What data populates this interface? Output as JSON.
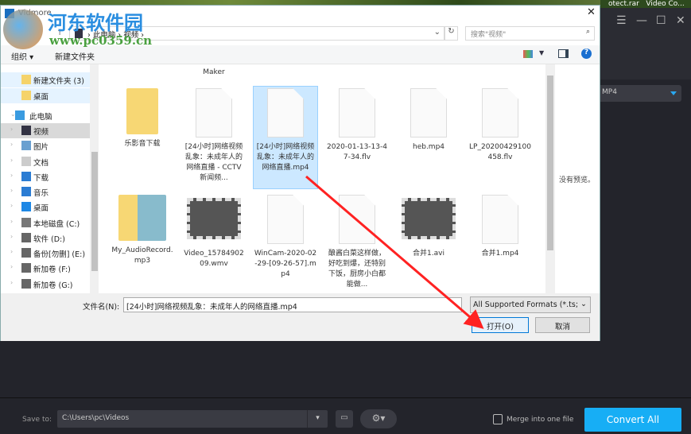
{
  "background_app": {
    "taskbar_items": [
      "otect.rar",
      "Video Co..."
    ],
    "format": "MP4",
    "save_to_label": "Save to:",
    "save_path": "C:\\Users\\pc\\Videos",
    "merge_label": "Merge into one file",
    "convert_button": "Convert All",
    "accent": "#17aef5"
  },
  "dialog": {
    "title": "Vidmore",
    "breadcrumb": [
      "此电脑",
      "视频"
    ],
    "search_placeholder": "搜索\"视频\"",
    "toolbar": {
      "organize": "组织 ▾",
      "new_folder": "新建文件夹"
    },
    "nav": [
      "新建文件夹 (3)",
      "桌面",
      "此电脑",
      "视频",
      "图片",
      "文档",
      "下载",
      "音乐",
      "桌面",
      "本地磁盘 (C:)",
      "软件 (D:)",
      "备份[勿删] (E:)",
      "新加卷 (F:)",
      "新加卷 (G:)"
    ],
    "top_partial_label": "Maker",
    "files": [
      {
        "name": "乐影音下载",
        "icon": "folder"
      },
      {
        "name": "[24小时]网络视频乱象：未成年人的网络直播 - CCTV 新闻频...",
        "icon": "doc"
      },
      {
        "name": "[24小时]网络视频乱象：未成年人的网络直播.mp4",
        "icon": "doc",
        "selected": true
      },
      {
        "name": "2020-01-13-13-47-34.flv",
        "icon": "doc"
      },
      {
        "name": "heb.mp4",
        "icon": "doc"
      },
      {
        "name": "LP_20200429100458.flv",
        "icon": "doc"
      },
      {
        "name": "My_AudioRecord.mp3",
        "icon": "folder-pics"
      },
      {
        "name": "Video_1578490209.wmv",
        "icon": "video"
      },
      {
        "name": "WinCam-2020-02-29-[09-26-57].mp4",
        "icon": "doc"
      },
      {
        "name": "酿酱白菜这样做，好吃到爆，还特别下饭，厨房小白都能做...",
        "icon": "doc"
      },
      {
        "name": "合并1.avi",
        "icon": "video"
      },
      {
        "name": "合并1.mp4",
        "icon": "doc"
      }
    ],
    "preview_text": "没有预览。",
    "filename_label": "文件名(N):",
    "filename_value": "[24小时]网络视频乱象：未成年人的网络直播.mp4",
    "filter": "All Supported Formats (*.ts;",
    "open_button": "打开(O)",
    "cancel_button": "取消"
  },
  "watermark": {
    "name": "河东软件园",
    "url": "www.pc0359.cn"
  }
}
